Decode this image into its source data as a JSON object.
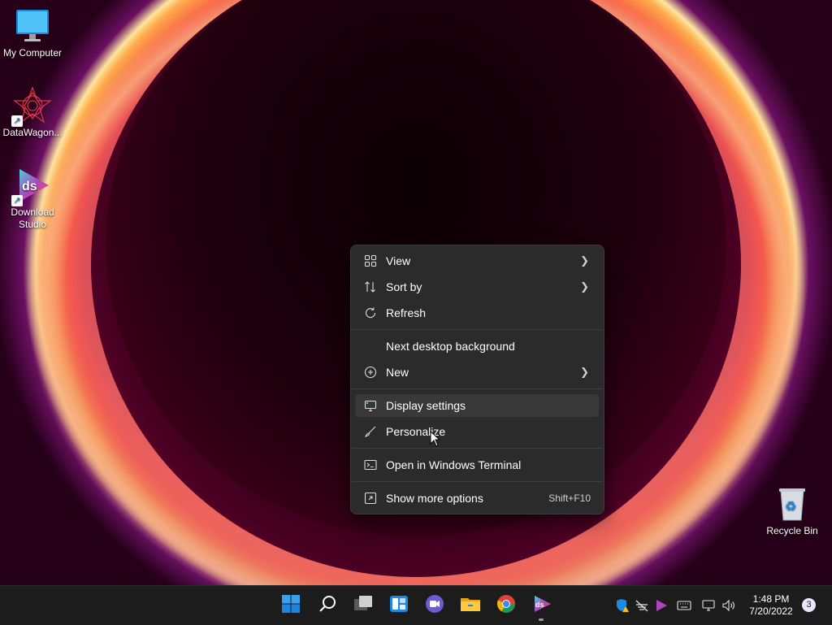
{
  "desktop": {
    "icons": [
      {
        "label": "My Computer",
        "icon": "monitor-icon"
      },
      {
        "label": "DataWagon...",
        "icon": "datawagon-icon"
      },
      {
        "label": "Download Studio",
        "icon": "download-studio-icon"
      },
      {
        "label": "Recycle Bin",
        "icon": "recycle-bin-icon"
      }
    ]
  },
  "context_menu": {
    "items": [
      {
        "label": "View",
        "icon": "grid-icon",
        "submenu": true
      },
      {
        "label": "Sort by",
        "icon": "sort-icon",
        "submenu": true
      },
      {
        "label": "Refresh",
        "icon": "refresh-icon",
        "submenu": false
      },
      {
        "label": "Next desktop background",
        "icon": "",
        "submenu": false
      },
      {
        "label": "New",
        "icon": "plus-circle-icon",
        "submenu": true
      },
      {
        "label": "Display settings",
        "icon": "display-icon",
        "submenu": false,
        "highlighted": true
      },
      {
        "label": "Personalize",
        "icon": "brush-icon",
        "submenu": false
      },
      {
        "label": "Open in Windows Terminal",
        "icon": "terminal-icon",
        "submenu": false
      },
      {
        "label": "Show more options",
        "icon": "more-options-icon",
        "submenu": false,
        "shortcut": "Shift+F10"
      }
    ]
  },
  "taskbar": {
    "apps": [
      {
        "name": "start",
        "icon": "windows-logo-icon"
      },
      {
        "name": "search",
        "icon": "search-icon"
      },
      {
        "name": "task-view",
        "icon": "task-view-icon"
      },
      {
        "name": "widgets",
        "icon": "widgets-icon"
      },
      {
        "name": "chat",
        "icon": "chat-icon"
      },
      {
        "name": "file-explorer",
        "icon": "folder-icon"
      },
      {
        "name": "chrome",
        "icon": "chrome-icon"
      },
      {
        "name": "download-studio",
        "icon": "download-studio-icon",
        "running": true
      }
    ],
    "tray": [
      "defender-warning-icon",
      "network-off-icon",
      "download-studio-tray-icon",
      "keyboard-icon",
      "display-network-icon",
      "volume-icon"
    ],
    "time": "1:48 PM",
    "date": "7/20/2022",
    "notifications": "3"
  },
  "colors": {
    "menu_bg": "#2b2b2b",
    "menu_highlight": "#383838",
    "taskbar_bg": "#1c1c1c",
    "accent": "#0078d4"
  }
}
